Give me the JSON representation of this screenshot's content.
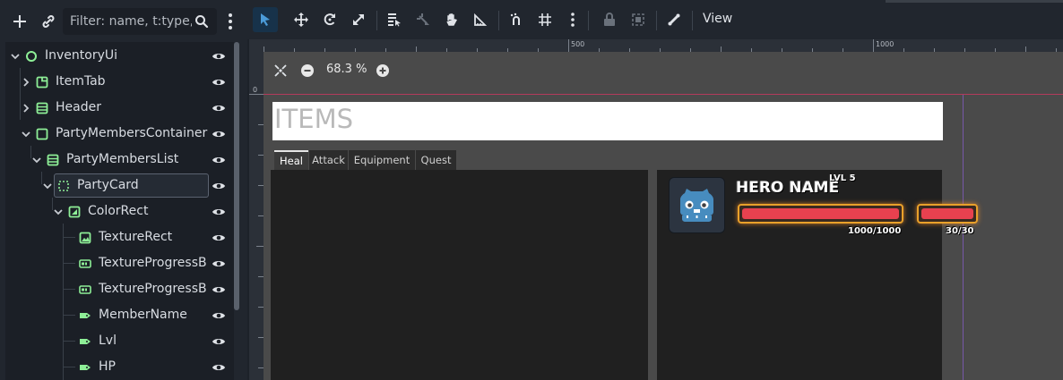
{
  "scene_dock": {
    "filter_placeholder": "Filter: name, t:type,",
    "toolbar_icons": [
      "add-node-icon",
      "link-icon",
      "search-icon",
      "kebab-menu-icon"
    ],
    "tree": [
      {
        "label": "InventoryUi",
        "icon": "control-node-icon",
        "expanded": true
      },
      {
        "label": "ItemTab",
        "icon": "tab-container-icon",
        "expanded": false
      },
      {
        "label": "Header",
        "icon": "vbox-icon",
        "expanded": false
      },
      {
        "label": "PartyMembersContainer",
        "icon": "panel-container-icon",
        "expanded": true
      },
      {
        "label": "PartyMembersList",
        "icon": "vbox-icon",
        "expanded": true
      },
      {
        "label": "PartyCard",
        "icon": "control-node-icon",
        "expanded": true,
        "selected": true
      },
      {
        "label": "ColorRect",
        "icon": "color-rect-icon",
        "expanded": true
      },
      {
        "label": "TextureRect",
        "icon": "texture-rect-icon"
      },
      {
        "label": "TextureProgressB",
        "icon": "texture-progress-icon"
      },
      {
        "label": "TextureProgressB",
        "icon": "texture-progress-icon"
      },
      {
        "label": "MemberName",
        "icon": "label-icon"
      },
      {
        "label": "Lvl",
        "icon": "label-icon"
      },
      {
        "label": "HP",
        "icon": "label-icon"
      }
    ]
  },
  "toolbar": {
    "view_label": "View",
    "tools": [
      "select-icon",
      "move-icon",
      "rotate-icon",
      "scale-icon",
      "list-select-icon",
      "pivot-icon",
      "pan-icon",
      "ruler-icon",
      "smart-snap-icon",
      "grid-snap-icon",
      "more-icon",
      "lock-icon",
      "group-icon",
      "bone-icon"
    ]
  },
  "viewport": {
    "ruler_labels": [
      "500",
      "1000"
    ],
    "ruler_left_label": "0",
    "zoom": "68.3 %",
    "items_title": "ITEMS",
    "tabs": [
      "Heal",
      "Attack",
      "Equipment",
      "Quest"
    ],
    "active_tab": "Heal",
    "hero": {
      "name": "HERO NAME",
      "lvl": "LVL 5",
      "hp_text": "1000/1000",
      "mp_text": "30/30",
      "hp_fraction": 1.0,
      "mp_fraction": 1.0
    }
  },
  "colors": {
    "accent": "#4b9bd8",
    "node_green": "#8eef97",
    "guide_red": "#b43a5c",
    "guide_purple": "#7657a8",
    "bar_fill": "#e8414f",
    "bar_border": "#e9a12a"
  }
}
